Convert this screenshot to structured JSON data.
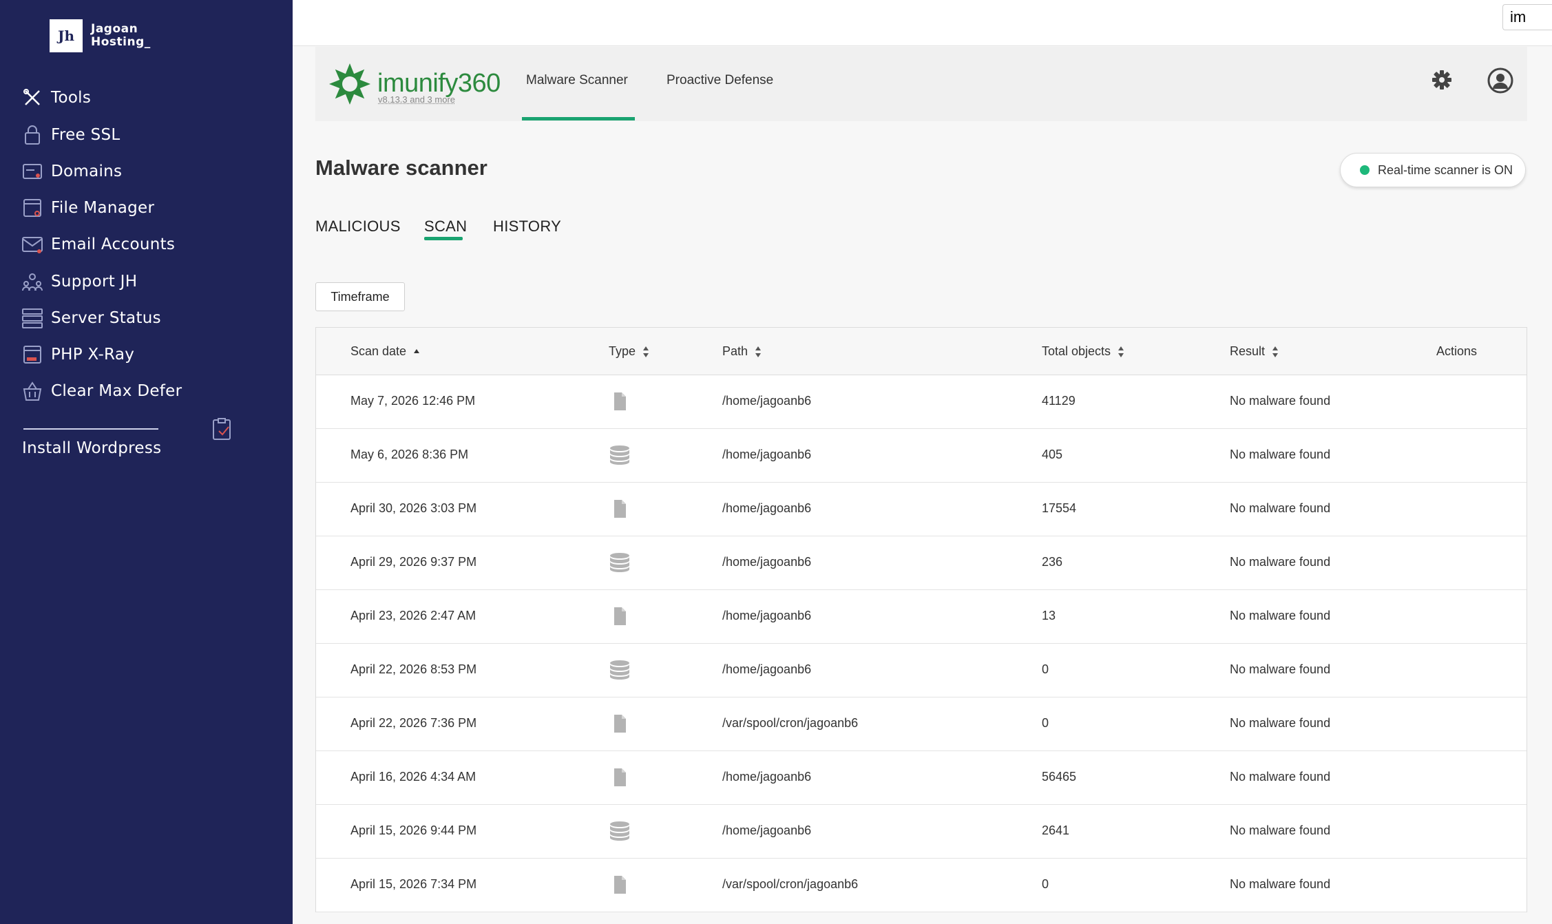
{
  "brand": {
    "logo": "Jh",
    "line1": "Jagoan",
    "line2": "Hosting_"
  },
  "sidebar": {
    "items": [
      {
        "label": "Tools",
        "icon": "tools-icon"
      },
      {
        "label": "Free SSL",
        "icon": "lock-icon"
      },
      {
        "label": "Domains",
        "icon": "domain-icon"
      },
      {
        "label": "File Manager",
        "icon": "file-manager-icon"
      },
      {
        "label": "Email Accounts",
        "icon": "email-icon"
      },
      {
        "label": "Support JH",
        "icon": "support-icon"
      },
      {
        "label": "Server Status",
        "icon": "server-icon"
      },
      {
        "label": "PHP X-Ray",
        "icon": "php-icon"
      },
      {
        "label": "Clear Max Defer",
        "icon": "basket-icon"
      }
    ],
    "install": "Install Wordpress"
  },
  "topbar": {
    "search_value": "im"
  },
  "imunify": {
    "name": "imunify360",
    "version": "v8.13.3 and 3 more",
    "tabs": [
      "Malware Scanner",
      "Proactive Defense"
    ]
  },
  "main": {
    "title": "Malware scanner",
    "realtime": "Real-time scanner is ON",
    "subtabs": [
      "MALICIOUS",
      "SCAN",
      "HISTORY"
    ],
    "timeframe": "Timeframe"
  },
  "table": {
    "headers": {
      "date": "Scan date",
      "type": "Type",
      "path": "Path",
      "total": "Total objects",
      "result": "Result",
      "actions": "Actions"
    },
    "rows": [
      {
        "date": "May 7, 2026 12:46 PM",
        "type": "file",
        "path": "/home/jagoanb6",
        "total": "41129",
        "result": "No malware found"
      },
      {
        "date": "May 6, 2026 8:36 PM",
        "type": "database",
        "path": "/home/jagoanb6",
        "total": "405",
        "result": "No malware found"
      },
      {
        "date": "April 30, 2026 3:03 PM",
        "type": "file",
        "path": "/home/jagoanb6",
        "total": "17554",
        "result": "No malware found"
      },
      {
        "date": "April 29, 2026 9:37 PM",
        "type": "database",
        "path": "/home/jagoanb6",
        "total": "236",
        "result": "No malware found"
      },
      {
        "date": "April 23, 2026 2:47 AM",
        "type": "file",
        "path": "/home/jagoanb6",
        "total": "13",
        "result": "No malware found"
      },
      {
        "date": "April 22, 2026 8:53 PM",
        "type": "database",
        "path": "/home/jagoanb6",
        "total": "0",
        "result": "No malware found"
      },
      {
        "date": "April 22, 2026 7:36 PM",
        "type": "file",
        "path": "/var/spool/cron/jagoanb6",
        "total": "0",
        "result": "No malware found"
      },
      {
        "date": "April 16, 2026 4:34 AM",
        "type": "file",
        "path": "/home/jagoanb6",
        "total": "56465",
        "result": "No malware found"
      },
      {
        "date": "April 15, 2026 9:44 PM",
        "type": "database",
        "path": "/home/jagoanb6",
        "total": "2641",
        "result": "No malware found"
      },
      {
        "date": "April 15, 2026 7:34 PM",
        "type": "file",
        "path": "/var/spool/cron/jagoanb6",
        "total": "0",
        "result": "No malware found"
      }
    ]
  },
  "colors": {
    "sidebar": "#1f2458",
    "accent": "#1aa370",
    "brand_green": "#2c8a3e"
  }
}
